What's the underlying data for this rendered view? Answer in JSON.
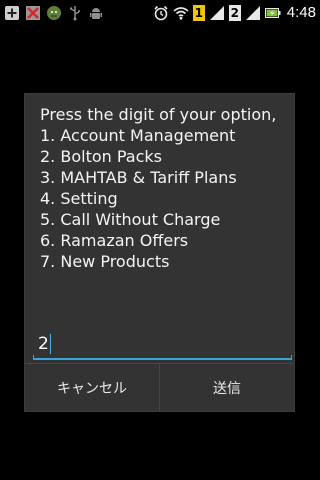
{
  "status_bar": {
    "sim1_label": "1",
    "sim2_label": "2",
    "time": "4:48",
    "icons": [
      "add-icon",
      "no-signal-app-icon",
      "android-robot-icon",
      "usb-icon",
      "android-debug-icon",
      "alarm-icon",
      "wifi-icon",
      "signal-icon",
      "battery-charging-icon"
    ]
  },
  "dialog": {
    "message_lines": [
      "Press the digit of your option,",
      "1. Account Management",
      "2. Bolton Packs",
      "3. MAHTAB & Tariff Plans",
      "4. Setting",
      "5. Call Without Charge",
      "6. Ramazan Offers",
      "7. New Products"
    ],
    "input_value": "2",
    "cancel_label": "キャンセル",
    "send_label": "送信"
  },
  "colors": {
    "background": "#000000",
    "dialog_bg": "#333333",
    "accent": "#33a6db",
    "text": "#f4f4f4"
  }
}
